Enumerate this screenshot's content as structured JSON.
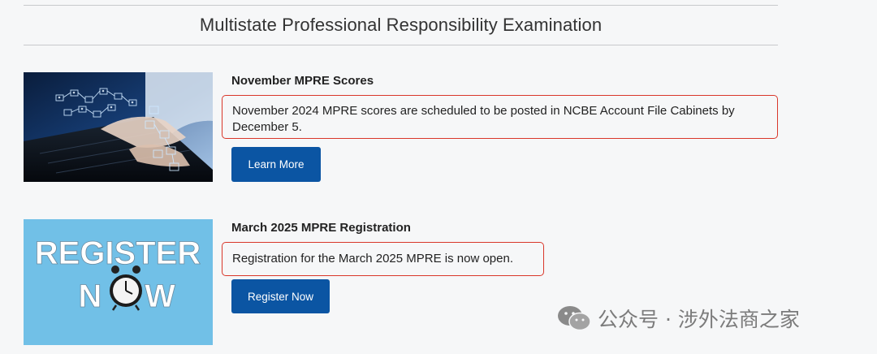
{
  "header": {
    "title": "Multistate Professional Responsibility Examination"
  },
  "cards": [
    {
      "heading": "November MPRE Scores",
      "notice": "November 2024 MPRE scores are scheduled to be posted in NCBE Account File Cabinets by December 5.",
      "button_label": "Learn More"
    },
    {
      "heading": "March 2025 MPRE Registration",
      "notice": "Registration for the March 2025 MPRE is now open.",
      "button_label": "Register Now",
      "image_text": {
        "line1": "REGISTER",
        "line2a": "N",
        "line2b": "W"
      }
    }
  ],
  "watermark": {
    "text": "公众号 · 涉外法商之家"
  },
  "colors": {
    "accent_button": "#0b55a3",
    "highlight_border": "#d9372a",
    "background": "#f6f7f8"
  }
}
